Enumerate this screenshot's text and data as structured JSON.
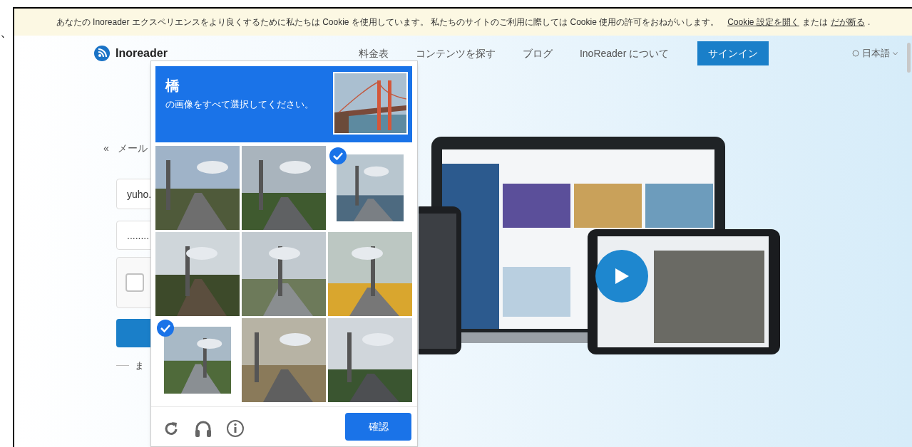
{
  "stray_mark": "、",
  "cookie_banner": {
    "text": "あなたの Inoreader エクスペリエンスをより良くするために私たちは Cookie を使用しています。 私たちのサイトのご利用に際しては Cookie 使用の許可をおねがいします。",
    "settings_link": "Cookie 設定を開く",
    "or": "または",
    "decline_link": "だが断る",
    "end": "."
  },
  "nav": {
    "logo": "Inoreader",
    "links": [
      "料金表",
      "コンテンツを探す",
      "ブログ",
      "InoReader について"
    ],
    "signin": "サインイン",
    "language": "日本語"
  },
  "login": {
    "back": "«",
    "heading": "メール",
    "email_value": "yuho.",
    "password_value": "........",
    "captcha_checked": false,
    "or_text": "ま"
  },
  "captcha": {
    "target": "橋",
    "instruction": "の画像をすべて選択してください。",
    "tiles": [
      {
        "selected": false
      },
      {
        "selected": false
      },
      {
        "selected": true
      },
      {
        "selected": false
      },
      {
        "selected": false
      },
      {
        "selected": false
      },
      {
        "selected": true
      },
      {
        "selected": false
      },
      {
        "selected": false
      }
    ],
    "verify": "確認"
  }
}
